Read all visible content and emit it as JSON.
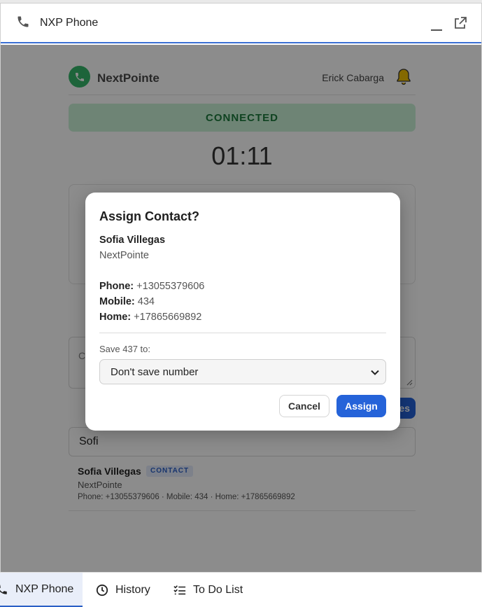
{
  "window": {
    "title": "NXP Phone"
  },
  "header": {
    "brand": "NextPointe",
    "user": "Erick Cabarga"
  },
  "status": {
    "label": "CONNECTED",
    "color": "#1d7a3c"
  },
  "timer": "01:11",
  "notes": {
    "placeholder": "C"
  },
  "save_button": {
    "label": "es"
  },
  "search": {
    "value": "Sofi"
  },
  "result": {
    "name": "Sofia Villegas",
    "badge": "CONTACT",
    "company": "NextPointe",
    "details": "Phone: +13055379606 · Mobile: 434 · Home: +17865669892"
  },
  "modal": {
    "title": "Assign Contact?",
    "name": "Sofia Villegas",
    "company": "NextPointe",
    "phone_label": "Phone:",
    "phone": "+13055379606",
    "mobile_label": "Mobile:",
    "mobile": "434",
    "home_label": "Home:",
    "home": "+17865669892",
    "save_label": "Save 437 to:",
    "select_value": "Don't save number",
    "cancel": "Cancel",
    "assign": "Assign"
  },
  "tabs": [
    {
      "label": "NXP Phone",
      "icon": "phone-icon",
      "active": true
    },
    {
      "label": "History",
      "icon": "clock-icon",
      "active": false
    },
    {
      "label": "To Do List",
      "icon": "checklist-icon",
      "active": false
    }
  ],
  "colors": {
    "accent": "#2563d9",
    "status_bg": "#c9f0d6",
    "brand_green": "#36b66a"
  }
}
